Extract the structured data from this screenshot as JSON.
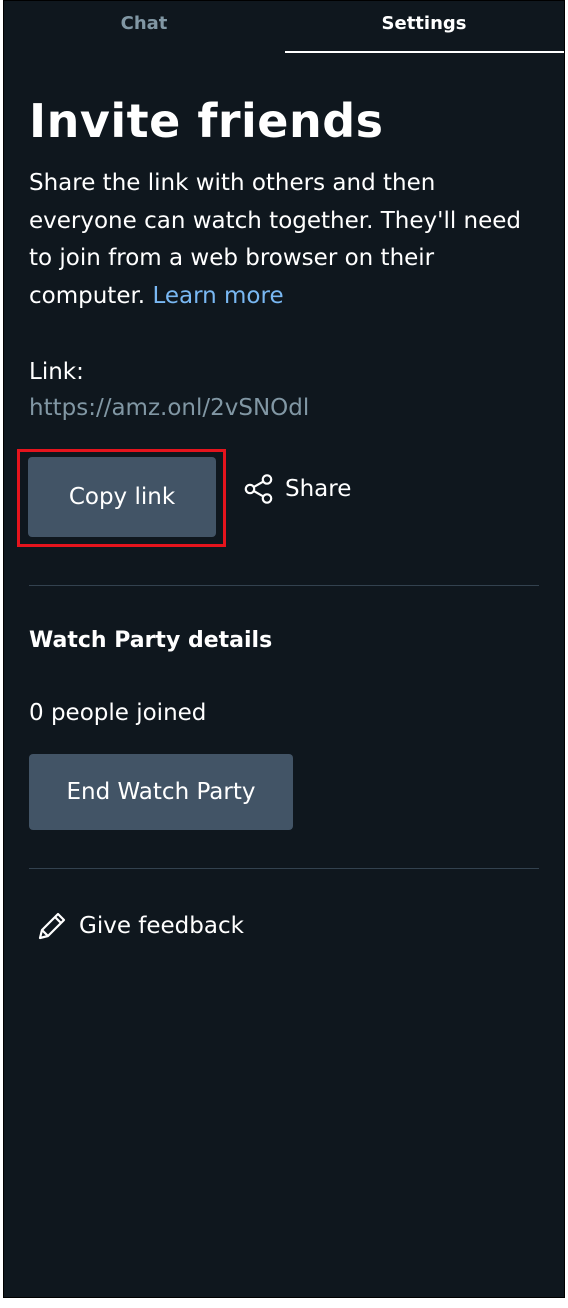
{
  "tabs": [
    {
      "label": "Chat",
      "active": false
    },
    {
      "label": "Settings",
      "active": true
    }
  ],
  "header": {
    "title": "Invite friends"
  },
  "description": {
    "text": "Share the link with others and then everyone can watch together. They'll need to join from a web browser on their computer.",
    "learn_more": "Learn more"
  },
  "link": {
    "label": "Link:",
    "url": "https://amz.onl/2vSNOdl"
  },
  "actions": {
    "copy_label": "Copy link",
    "share_label": "Share"
  },
  "details": {
    "title": "Watch Party details",
    "people_joined": "0 people joined",
    "end_label": "End Watch Party"
  },
  "feedback": {
    "label": "Give feedback"
  },
  "colors": {
    "background": "#0f171e",
    "button": "#425466",
    "link_accent": "#79b8f3",
    "muted_text": "#8197a4",
    "highlight": "#e5141d"
  },
  "icons": {
    "share": "share-icon",
    "feedback": "pencil-icon"
  }
}
